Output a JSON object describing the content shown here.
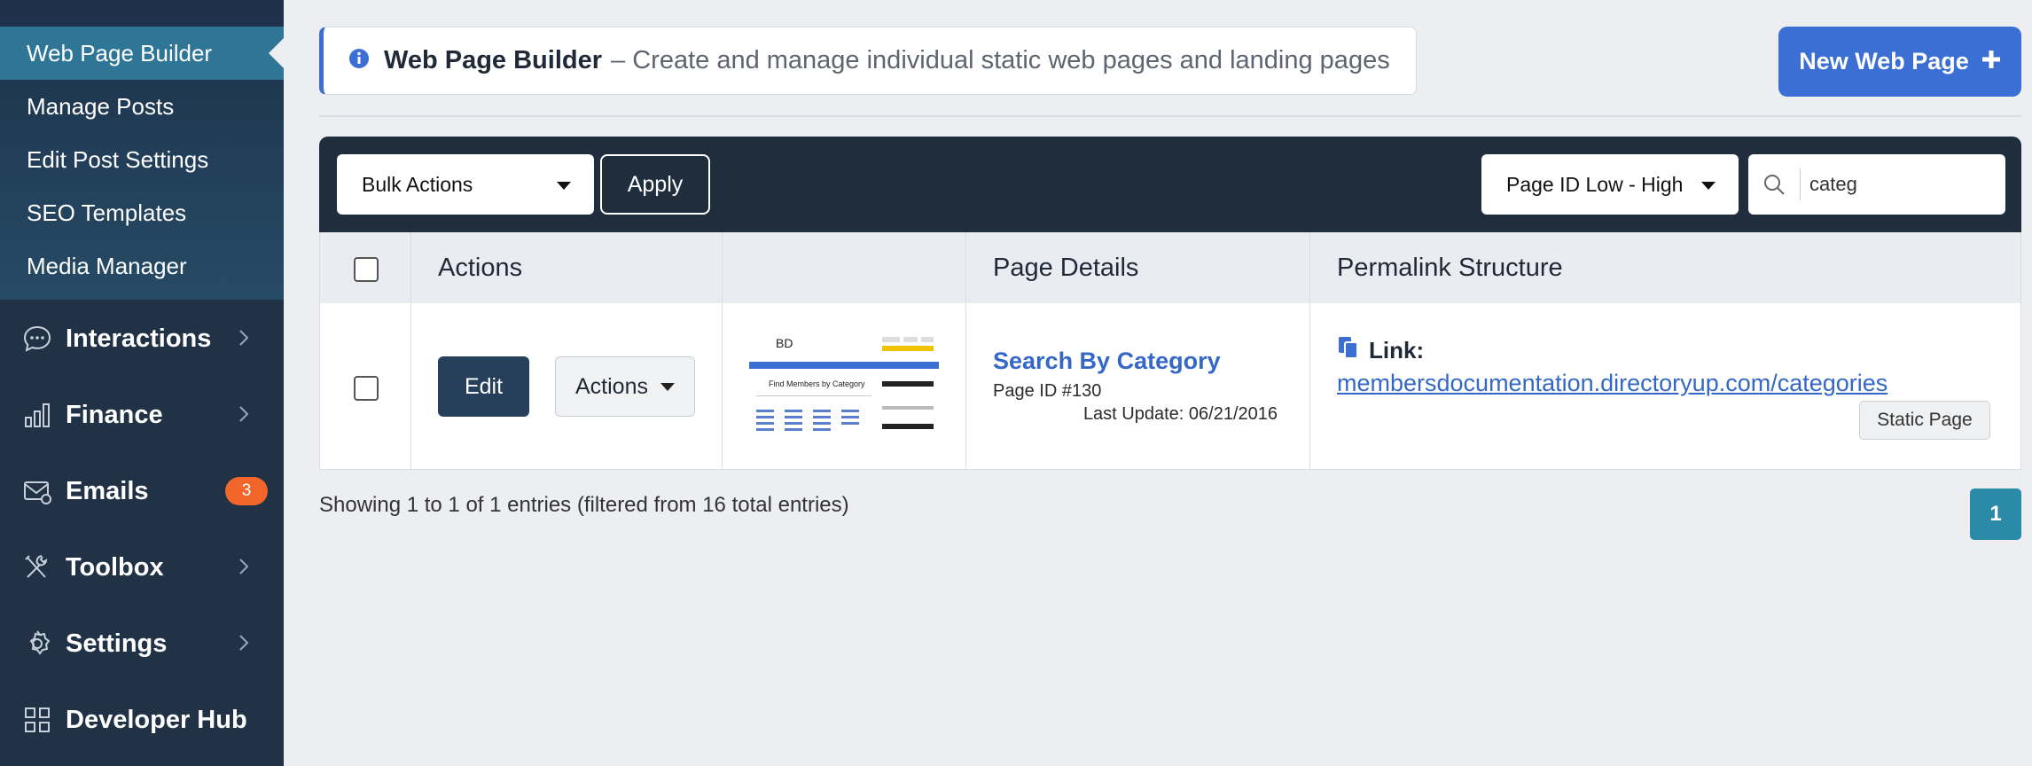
{
  "sidebar": {
    "sub_items": [
      {
        "label": "Web Page Builder",
        "active": true
      },
      {
        "label": "Manage Posts"
      },
      {
        "label": "Edit Post Settings"
      },
      {
        "label": "SEO Templates"
      },
      {
        "label": "Media Manager"
      }
    ],
    "nav_items": [
      {
        "label": "Interactions",
        "icon": "chat-icon"
      },
      {
        "label": "Finance",
        "icon": "bar-chart-icon"
      },
      {
        "label": "Emails",
        "icon": "mail-icon",
        "badge": "3"
      },
      {
        "label": "Toolbox",
        "icon": "tools-icon"
      },
      {
        "label": "Settings",
        "icon": "gear-icon"
      },
      {
        "label": "Developer Hub",
        "icon": "grid-icon"
      }
    ]
  },
  "header": {
    "info_title": "Web Page Builder",
    "info_desc": "– Create and manage individual static web pages and landing pages",
    "new_button": "New Web Page"
  },
  "toolbar": {
    "bulk_actions": "Bulk Actions",
    "apply": "Apply",
    "sort": "Page ID Low - High",
    "search_value": "categ"
  },
  "table": {
    "headers": {
      "actions": "Actions",
      "thumbnail": "",
      "details": "Page Details",
      "permalink": "Permalink Structure"
    },
    "rows": [
      {
        "edit": "Edit",
        "actions": "Actions",
        "title": "Search By Category",
        "page_id": "Page ID #130",
        "last_update": "Last Update: 06/21/2016",
        "link_label": "Link:",
        "url": "membersdocumentation.directoryup.com/categories",
        "type": "Static Page",
        "thumb": {
          "logo": "BD",
          "heading": "Find Members by Category"
        }
      }
    ]
  },
  "footer": {
    "showing": "Showing 1 to 1 of 1 entries (filtered from 16 total entries)",
    "page": "1"
  },
  "colors": {
    "accent": "#3b6fd4",
    "sidebar": "#223246",
    "active": "#2f7596",
    "badge": "#f2662c",
    "pager": "#2a8aa8"
  }
}
